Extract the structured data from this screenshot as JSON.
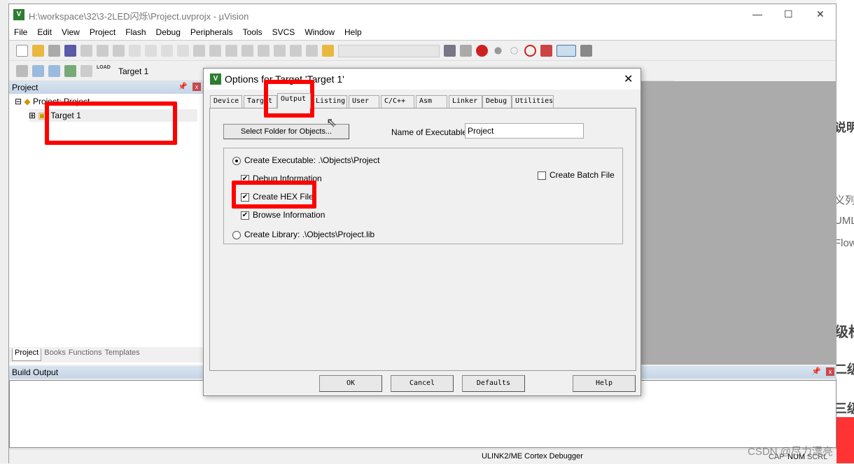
{
  "window": {
    "title": "H:\\workspace\\32\\3-2LED闪烁\\Project.uvprojx - µVision",
    "logo": "V"
  },
  "menu": [
    "File",
    "Edit",
    "View",
    "Project",
    "Flash",
    "Debug",
    "Peripherals",
    "Tools",
    "SVCS",
    "Window",
    "Help"
  ],
  "toolbar2": {
    "target": "Target 1",
    "load": "LOAD"
  },
  "project_panel": {
    "title": "Project",
    "root": "Project: Project",
    "target": "Target 1"
  },
  "bottom_tabs": [
    "Project",
    "Books",
    "Functions",
    "Templates"
  ],
  "build_output": {
    "title": "Build Output"
  },
  "status": {
    "debugger": "ULINK2/ME Cortex Debugger",
    "cap": "CAP",
    "num": "NUM",
    "scrl": "SCRL"
  },
  "dialog": {
    "title": "Options for Target 'Target 1'",
    "tabs": [
      "Device",
      "Target",
      "Output",
      "Listing",
      "User",
      "C/C++",
      "Asm",
      "Linker",
      "Debug",
      "Utilities"
    ],
    "active_tab": "Output",
    "select_folder": "Select Folder for Objects...",
    "name_label": "Name of Executable:",
    "name_value": "Project",
    "create_exe": "Create Executable:  .\\Objects\\Project",
    "debug_info": "Debug Information",
    "create_hex": "Create HEX File",
    "browse_info": "Browse Information",
    "create_lib": "Create Library:  .\\Objects\\Project.lib",
    "create_batch": "Create Batch File",
    "buttons": {
      "ok": "OK",
      "cancel": "Cancel",
      "defaults": "Defaults",
      "help": "Help"
    }
  },
  "background_page": {
    "texts": [
      "说明",
      "义列表",
      "UML",
      "Flow",
      "级标",
      "二级",
      "三级"
    ],
    "watermark": "CSDN @尽力漂亮"
  },
  "highlight_color": "#ff0000"
}
